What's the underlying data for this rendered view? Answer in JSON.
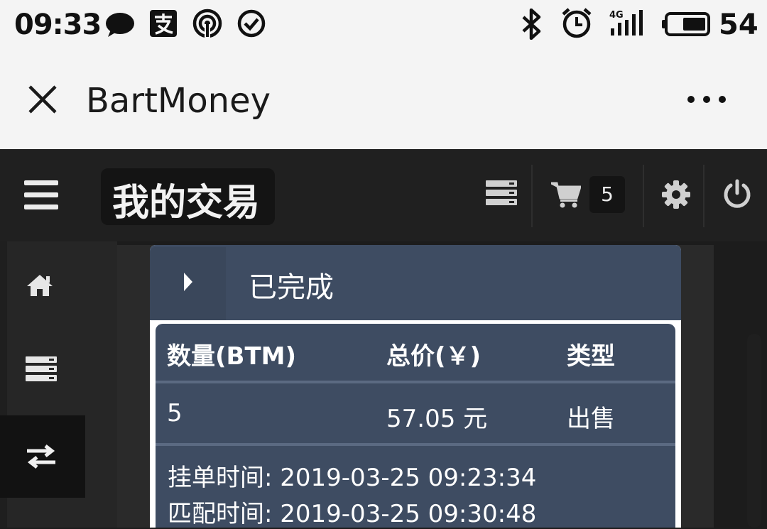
{
  "status_bar": {
    "time": "09:33",
    "battery_level": "54",
    "icons": [
      "chat-icon",
      "alipay-icon",
      "hotspot-icon",
      "check-circle-icon",
      "bluetooth-icon",
      "alarm-icon",
      "signal-4g-icon",
      "battery-icon"
    ]
  },
  "browser": {
    "title": "BartMoney",
    "icons": [
      "close-icon",
      "more-icon"
    ]
  },
  "app_header": {
    "title": "我的交易",
    "cart_count": "5",
    "icons": [
      "menu-icon",
      "list-icon",
      "cart-icon",
      "gear-icon",
      "power-icon"
    ]
  },
  "sidebar": {
    "items": [
      {
        "icon": "home-icon"
      },
      {
        "icon": "list-icon"
      },
      {
        "icon": "exchange-icon",
        "active": true
      }
    ]
  },
  "panel": {
    "title": "已完成",
    "columns": [
      "数量(BTM)",
      "总价(￥)",
      "类型"
    ],
    "rows": [
      {
        "quantity": "5",
        "total": "57.05 元",
        "type": "出售"
      }
    ],
    "order_time": "挂单时间: 2019-03-25 09:23:34",
    "match_time": "匹配时间: 2019-03-25 09:30:48"
  },
  "colors": {
    "panel_bg": "#3e4c62",
    "app_bg": "#1c1c1c",
    "bar_bg": "#f4f4f4"
  }
}
